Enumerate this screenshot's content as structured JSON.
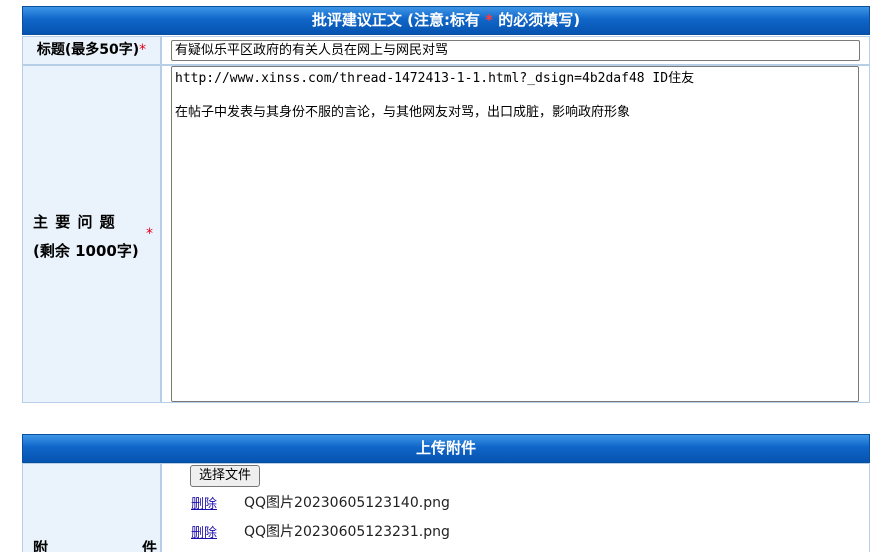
{
  "form_section": {
    "header_prefix": "批评建议正文 (注意:标有 ",
    "header_star": "*",
    "header_suffix": " 的必须填写)"
  },
  "title_field": {
    "label": "标题(最多50字)",
    "required_mark": "*",
    "value": "有疑似乐平区政府的有关人员在网上与网民对骂"
  },
  "main_issue": {
    "label_line1": "主 要 问 题",
    "label_line2": "(剩余 1000字)",
    "required_mark": "*",
    "line1": "http://www.xinss.com/thread-1472413-1-1.html?_dsign=4b2daf48  ID住友",
    "line2": "在帖子中发表与其身份不服的言论，与其他网友对骂，出口成脏，影响政府形象"
  },
  "upload_section": {
    "header": "上传附件",
    "label_char1": "附",
    "label_char2": "件",
    "choose_file_label": "选择文件",
    "attachments": [
      {
        "delete_label": "删除",
        "filename": "QQ图片20230605123140.png"
      },
      {
        "delete_label": "删除",
        "filename": "QQ图片20230605123231.png"
      }
    ]
  }
}
